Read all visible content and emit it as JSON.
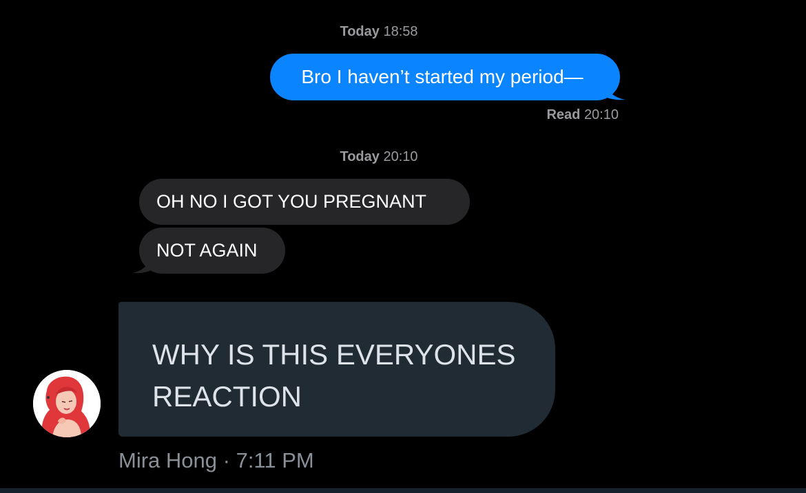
{
  "thread": {
    "timestamp_1_day": "Today",
    "timestamp_1_time": "18:58",
    "outgoing_message": "Bro I haven’t started my period—",
    "read_label": "Read",
    "read_time": "20:10",
    "timestamp_2_day": "Today",
    "timestamp_2_time": "20:10",
    "incoming_messages": [
      "OH NO I GOT YOU PREGNANT",
      "NOT AGAIN"
    ]
  },
  "reply": {
    "text": "WHY IS THIS EVERYONES REACTION",
    "author": "Mira Hong",
    "separator": "·",
    "time": "7:11 PM",
    "avatar_icon": "avatar-red-hair-illustration"
  },
  "colors": {
    "background": "#000000",
    "outgoing_bubble": "#0a84ff",
    "incoming_bubble": "#262629",
    "reply_bubble": "#202b33",
    "meta_text": "#8a9098"
  }
}
